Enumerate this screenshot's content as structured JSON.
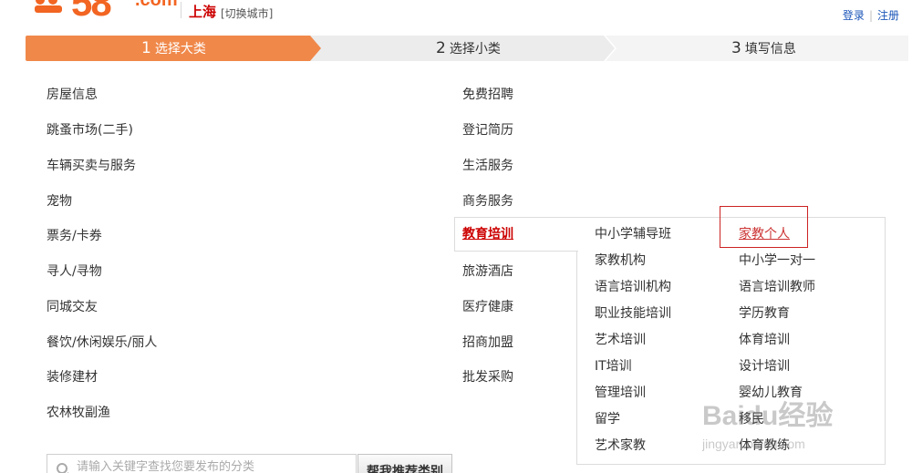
{
  "header": {
    "logo_text": "58",
    "logo_suffix": ".com",
    "city": "上海",
    "switch_city": "[切换城市]",
    "login": "登录",
    "link_sep": "|",
    "register": "注册"
  },
  "steps": [
    {
      "num": "1",
      "label": "选择大类",
      "state": "active"
    },
    {
      "num": "2",
      "label": "选择小类",
      "state": "inactive"
    },
    {
      "num": "3",
      "label": "填写信息",
      "state": "inactive"
    }
  ],
  "categories_left": [
    "房屋信息",
    "跳蚤市场(二手)",
    "车辆买卖与服务",
    "宠物",
    "票务/卡券",
    "寻人/寻物",
    "同城交友",
    "餐饮/休闲娱乐/丽人",
    "装修建材",
    "农林牧副渔"
  ],
  "categories_right": [
    "免费招聘",
    "登记简历",
    "生活服务",
    "商务服务",
    "教育培训",
    "旅游酒店",
    "医疗健康",
    "招商加盟",
    "批发采购"
  ],
  "active_category": "教育培训",
  "subcategories_col1": [
    "中小学辅导班",
    "家教机构",
    "语言培训机构",
    "职业技能培训",
    "艺术培训",
    "IT培训",
    "管理培训",
    "留学",
    "艺术家教"
  ],
  "subcategories_col2": [
    "家教个人",
    "中小学一对一",
    "语言培训教师",
    "学历教育",
    "体育培训",
    "设计培训",
    "婴幼儿教育",
    "移民",
    "体育教练"
  ],
  "highlighted_subcategory": "家教个人",
  "search": {
    "placeholder": "请输入关键字查找您要发布的分类",
    "button_label": "帮我推荐类别"
  },
  "watermark": {
    "text": "Baidu经验",
    "url": "jingyan.baidu.com"
  },
  "colors": {
    "brand_orange": "#f26522",
    "step_active": "#f0884a",
    "active_red": "#cc0000",
    "link_blue": "#1a55b8"
  }
}
